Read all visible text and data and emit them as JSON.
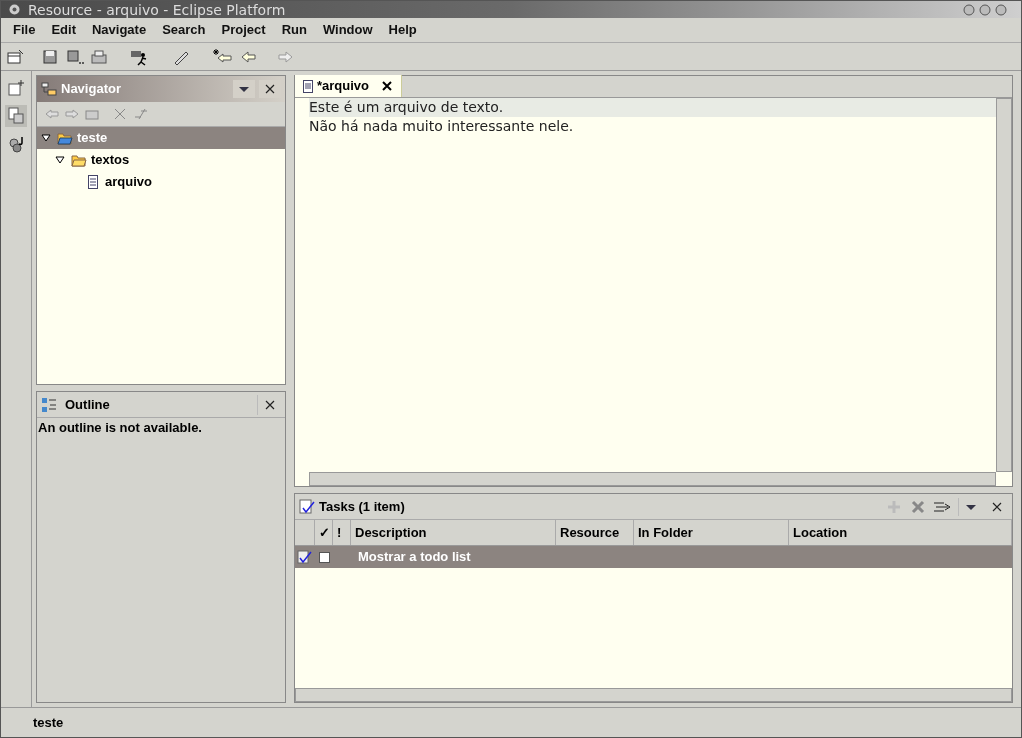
{
  "window": {
    "title": "Resource - arquivo - Eclipse Platform"
  },
  "menu": [
    "File",
    "Edit",
    "Navigate",
    "Search",
    "Project",
    "Run",
    "Window",
    "Help"
  ],
  "navigator": {
    "title": "Navigator",
    "tree": [
      {
        "label": "teste",
        "kind": "project",
        "expanded": true,
        "selected": true,
        "children": [
          {
            "label": "textos",
            "kind": "folder",
            "expanded": true,
            "selected": false,
            "children": [
              {
                "label": "arquivo",
                "kind": "file",
                "selected": false
              }
            ]
          }
        ]
      }
    ]
  },
  "outline": {
    "title": "Outline",
    "message": "An outline is not available."
  },
  "editor": {
    "tab": {
      "label": "*arquivo",
      "selected": true
    },
    "lines": [
      {
        "text": "Este é um arquivo de texto.",
        "current": true
      },
      {
        "text": "Não há nada muito interessante nele.",
        "current": false
      }
    ]
  },
  "tasks": {
    "title": "Tasks (1 item)",
    "columns": [
      "✓",
      "!",
      "Description",
      "Resource",
      "In Folder",
      "Location"
    ],
    "rows": [
      {
        "completed": false,
        "selected": true,
        "description": "Mostrar a todo list"
      }
    ]
  },
  "status_bar": "teste"
}
